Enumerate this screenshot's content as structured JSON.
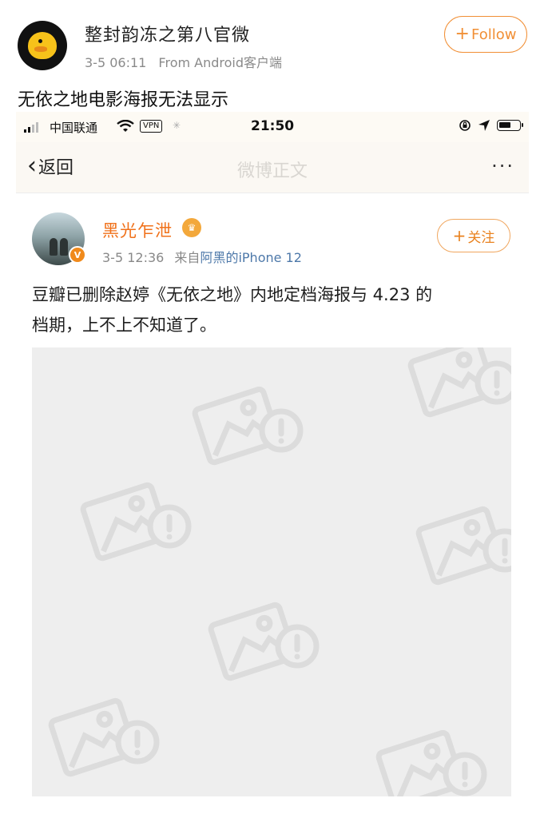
{
  "post": {
    "account_name": "整封韵冻之第八官微",
    "time": "3-5 06:11",
    "source": "From Android客户端",
    "follow_label": "Follow",
    "text": "无依之地电影海报无法显示"
  },
  "embedded": {
    "status_bar": {
      "carrier": "中国联通",
      "vpn": "VPN",
      "time": "21:50"
    },
    "nav": {
      "back_label": "返回",
      "title": "微博正文",
      "more": "···"
    },
    "author": {
      "name": "黑光乍泄",
      "time": "3-5 12:36",
      "source_prefix": "来自",
      "source_link": "阿黑的",
      "source_device": "iPhone 12",
      "follow_label": "关注",
      "verified_badge": "V"
    },
    "text_line1": "豆瓣已删除赵婷《无依之地》内地定档海报与 4.23 的",
    "text_line2": "档期，上不上不知道了。",
    "image_state": "broken-image-placeholder"
  },
  "colors": {
    "accent_orange": "#f18f35",
    "author_orange": "#f0711a",
    "link_blue": "#4d78a9",
    "placeholder_bg": "#eeeeee"
  }
}
